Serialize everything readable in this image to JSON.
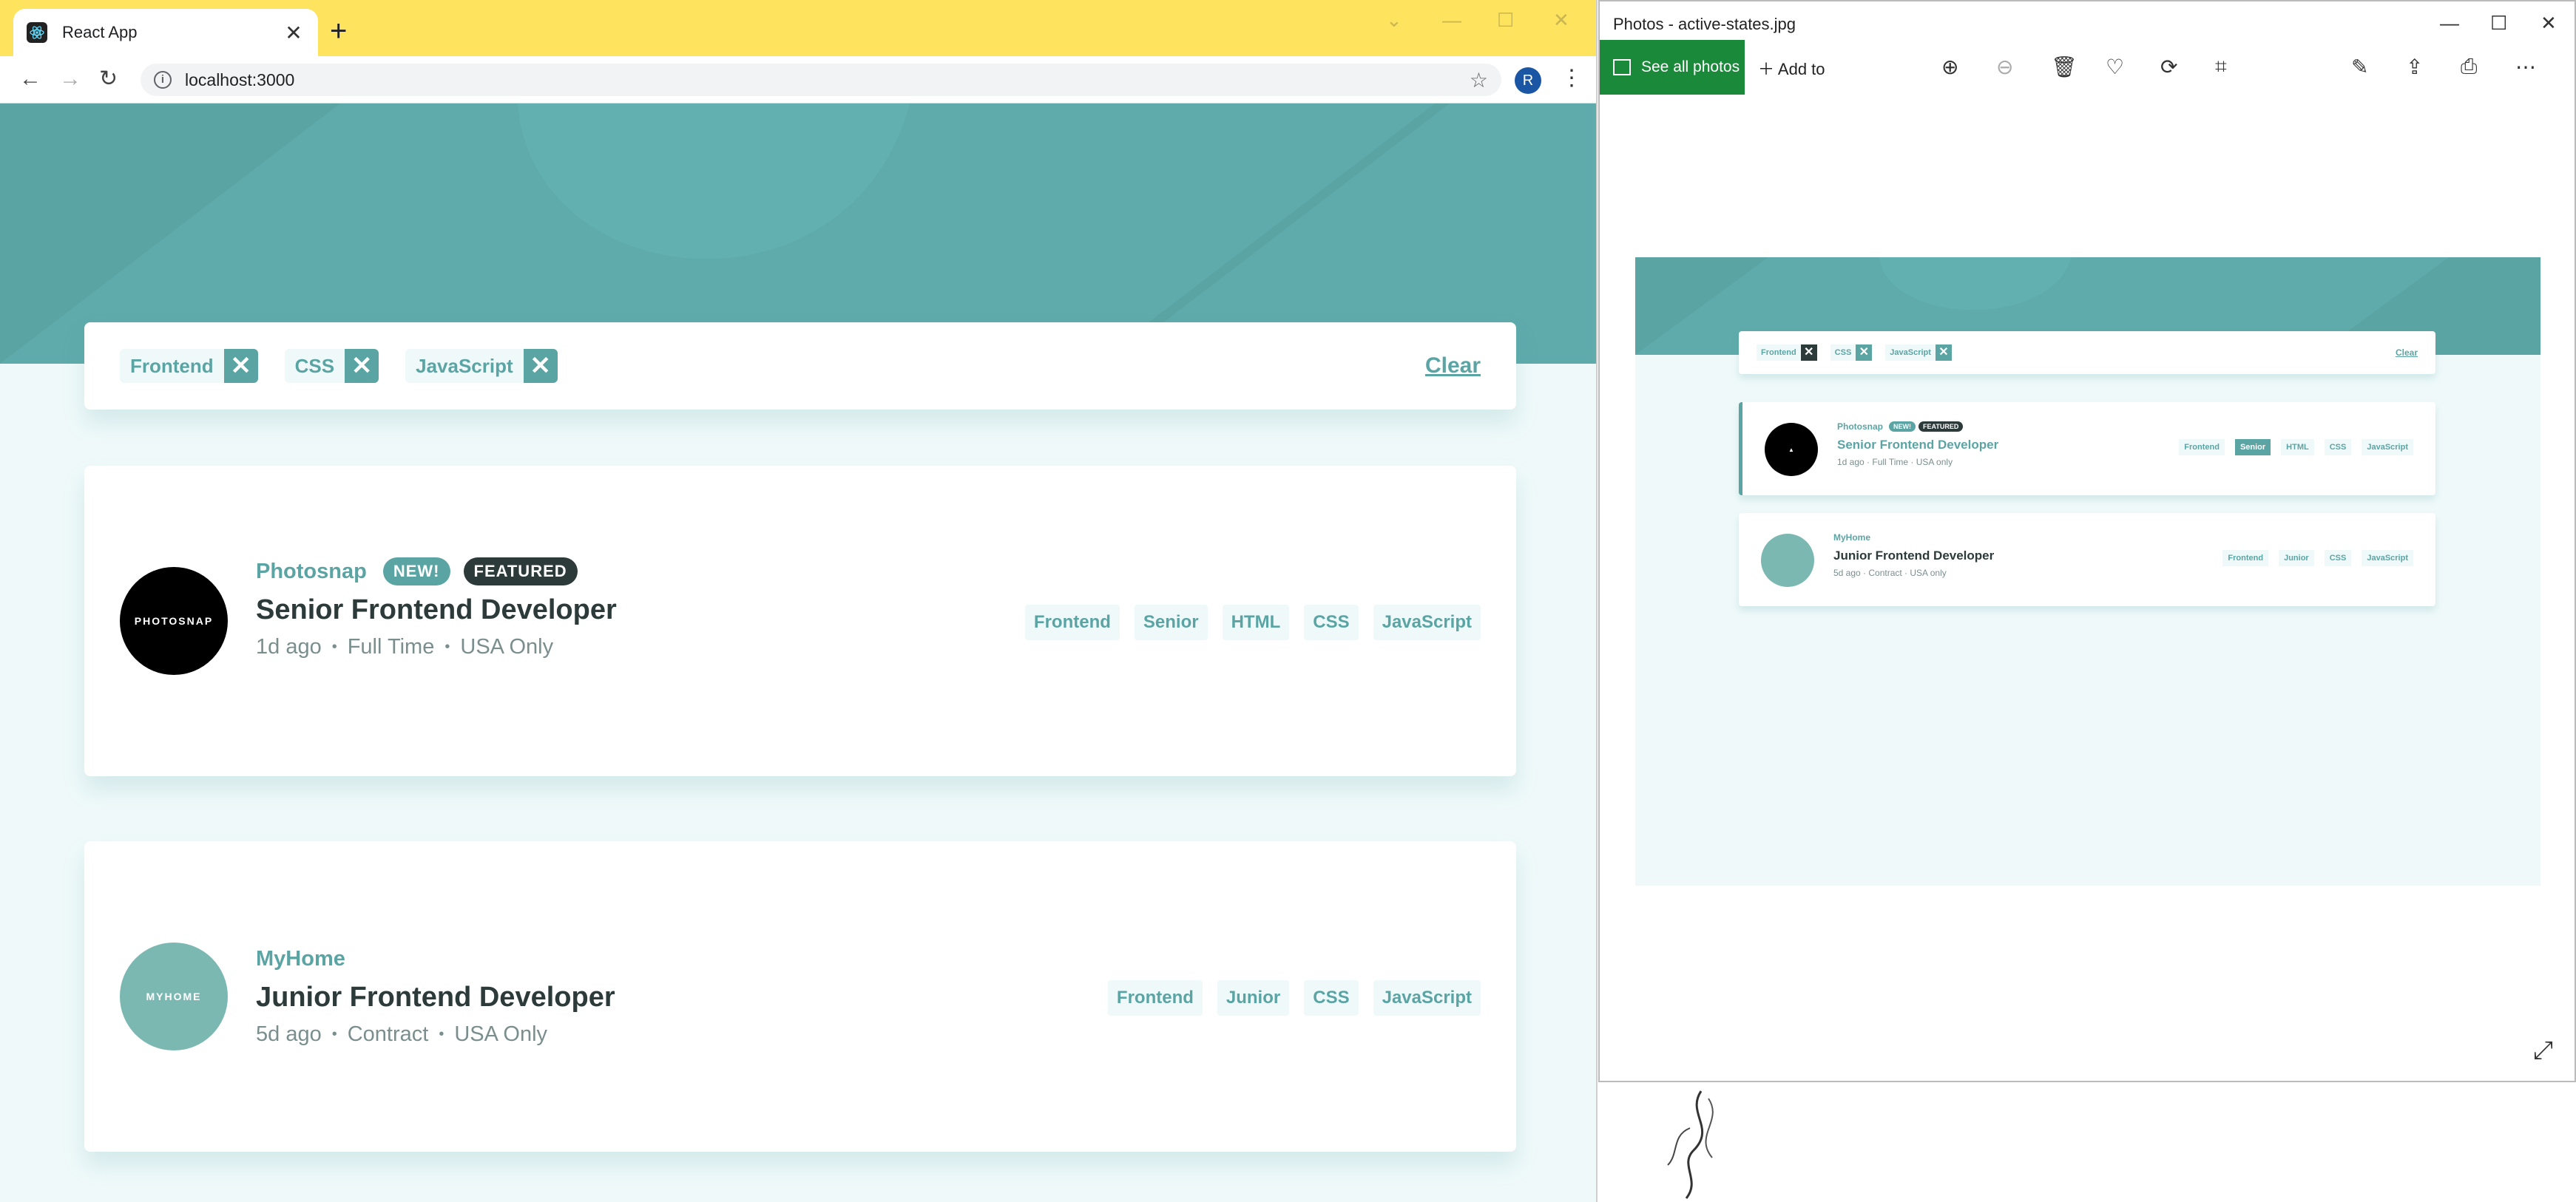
{
  "browser": {
    "tab_title": "React App",
    "tab_close": "✕",
    "new_tab": "+",
    "url": "localhost:3000",
    "profile_initial": "R"
  },
  "filters": {
    "chips": [
      "Frontend",
      "CSS",
      "JavaScript"
    ],
    "clear_label": "Clear"
  },
  "jobs": [
    {
      "company": "Photosnap",
      "logo_text": "PHOTOSNAP",
      "badge_new": "NEW!",
      "badge_featured": "FEATURED",
      "position": "Senior Frontend Developer",
      "posted": "1d ago",
      "contract": "Full Time",
      "location": "USA Only",
      "tags": [
        "Frontend",
        "Senior",
        "HTML",
        "CSS",
        "JavaScript"
      ]
    },
    {
      "company": "MyHome",
      "logo_text": "MYHOME",
      "position": "Junior Frontend Developer",
      "posted": "5d ago",
      "contract": "Contract",
      "location": "USA Only",
      "tags": [
        "Frontend",
        "Junior",
        "CSS",
        "JavaScript"
      ]
    }
  ],
  "photos_app": {
    "title": "Photos - active-states.jpg",
    "see_all": "See all photos",
    "add_to": "Add to",
    "preview": {
      "chips": [
        "Frontend",
        "CSS",
        "JavaScript"
      ],
      "clear": "Clear",
      "jobs": [
        {
          "company": "Photosnap",
          "badge_new": "NEW!",
          "badge_featured": "FEATURED",
          "position": "Senior Frontend Developer",
          "meta": "1d ago  ·  Full Time  ·  USA only",
          "tags": [
            "Frontend",
            "Senior",
            "HTML",
            "CSS",
            "JavaScript"
          ]
        },
        {
          "company": "MyHome",
          "position": "Junior Frontend Developer",
          "meta": "5d ago  ·  Contract  ·  USA only",
          "tags": [
            "Frontend",
            "Junior",
            "CSS",
            "JavaScript"
          ]
        }
      ]
    }
  },
  "colors": {
    "primary": "#5ba4a4",
    "dark": "#2c3a3a",
    "background": "#eff9fa",
    "chrome_bar": "#fee35f",
    "photos_accent": "#1a8a3a"
  }
}
